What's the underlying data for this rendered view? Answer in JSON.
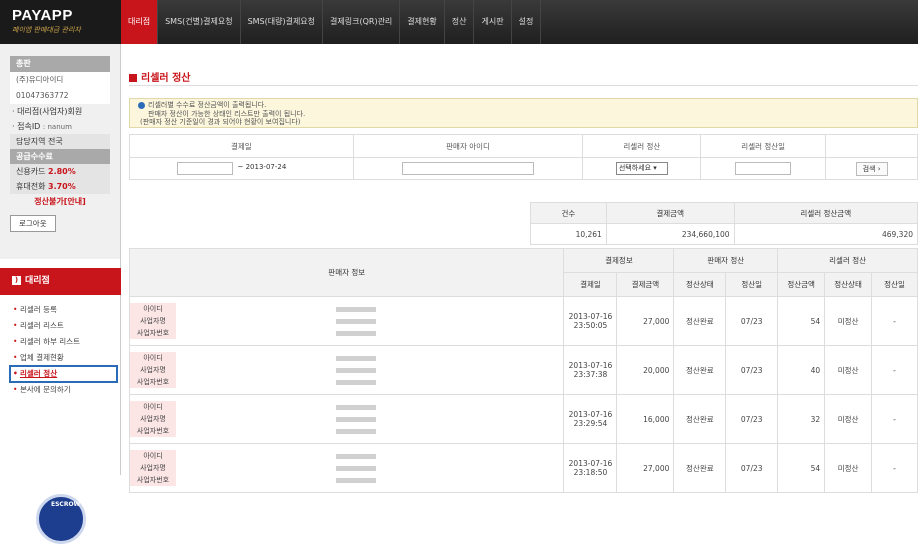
{
  "header": {
    "logo": "PAYAPP",
    "slogan": "페이앱 판매대금 관리자",
    "nav": [
      "대리점",
      "SMS(건별)결제요청",
      "SMS(대량)결제요청",
      "결제링크(QR)관리",
      "결제현황",
      "정산",
      "게시판",
      "설정"
    ]
  },
  "sidebar": {
    "branch_label": "총판",
    "branch_value": "(주)유디아이디",
    "phone": "01047363772",
    "member_label": "대리점(사업자)회원",
    "login_label": "접속ID",
    "login_id": ": nanum",
    "region_label": "담당지역",
    "region_value": "전국",
    "fee_header": "공급수수료",
    "card_label": "신용카드",
    "card_rate": "2.80%",
    "mobile_label": "휴대전화",
    "mobile_rate": "3.70%",
    "settle_status": "정산불가[안내]",
    "logout": "로그아웃",
    "section_title": "대리점",
    "menu": [
      "리셀러 등록",
      "리셀러 리스트",
      "리셀러 하부 리스트",
      "업체 결제현황",
      "리셀러 정산",
      "본사에 문의하기"
    ],
    "escrow": "ESCROW"
  },
  "main": {
    "title": "리셀러 정산",
    "notice": [
      "리셀러별 수수료 정산금액이 출력됩니다.",
      "판매자 정산이 가능한 상태인 리스트만 출력이 됩니다.",
      "(판매자 정산 기준일이 경과 되어야 현황이 보여집니다)"
    ],
    "search": {
      "headers": [
        "결제일",
        "판매자 아이디",
        "리셀러 정산",
        "리셀러 정산일"
      ],
      "date_to": "~ 2013-07-24",
      "select_value": "선택하세요",
      "search_button": "검색 ›"
    },
    "summary": {
      "headers": [
        "건수",
        "결제금액",
        "리셀러 정산금액"
      ],
      "values": [
        "10,261",
        "234,660,100",
        "469,320"
      ]
    },
    "list": {
      "group_headers": [
        "판매자 정보",
        "결제정보",
        "판매자 정산",
        "리셀러 정산"
      ],
      "sub_headers": [
        "결제일",
        "결제금액",
        "정산상태",
        "정산일",
        "정산금액",
        "정산상태",
        "정산일"
      ],
      "seller_labels": [
        "아이디",
        "사업자명",
        "사업자번호"
      ],
      "rows": [
        {
          "date": "2013-07-16",
          "time": "23:50:05",
          "amount": "27,000",
          "s_status": "정산완료",
          "s_date": "07/23",
          "r_amount": "54",
          "r_status": "미정산",
          "r_date": "-"
        },
        {
          "date": "2013-07-16",
          "time": "23:37:38",
          "amount": "20,000",
          "s_status": "정산완료",
          "s_date": "07/23",
          "r_amount": "40",
          "r_status": "미정산",
          "r_date": "-"
        },
        {
          "date": "2013-07-16",
          "time": "23:29:54",
          "amount": "16,000",
          "s_status": "정산완료",
          "s_date": "07/23",
          "r_amount": "32",
          "r_status": "미정산",
          "r_date": "-"
        },
        {
          "date": "2013-07-16",
          "time": "23:18:50",
          "amount": "27,000",
          "s_status": "정산완료",
          "s_date": "07/23",
          "r_amount": "54",
          "r_status": "미정산",
          "r_date": "-"
        }
      ]
    }
  }
}
